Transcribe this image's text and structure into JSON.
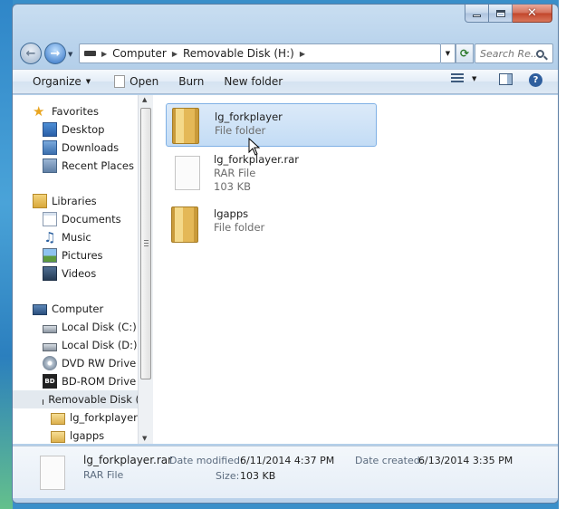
{
  "window": {
    "controls": {
      "minimize": "minimize",
      "maximize": "maximize",
      "close": "close"
    }
  },
  "address": {
    "breadcrumb": [
      "Computer",
      "Removable Disk (H:)"
    ],
    "search_placeholder": "Search Re..."
  },
  "toolbar": {
    "organize": "Organize",
    "open": "Open",
    "burn": "Burn",
    "new_folder": "New folder"
  },
  "nav": {
    "favorites": {
      "header": "Favorites",
      "items": [
        "Desktop",
        "Downloads",
        "Recent Places"
      ]
    },
    "libraries": {
      "header": "Libraries",
      "items": [
        "Documents",
        "Music",
        "Pictures",
        "Videos"
      ]
    },
    "computer": {
      "header": "Computer",
      "items": [
        "Local Disk (C:)",
        "Local Disk (D:)",
        "DVD RW Drive (E:",
        "BD-ROM Drive (G",
        "Removable Disk ("
      ],
      "subitems": [
        "lg_forkplayer",
        "lgapps"
      ]
    }
  },
  "files": [
    {
      "name": "lg_forkplayer",
      "type": "File folder",
      "size": "",
      "icon": "folder-icon",
      "selected": true
    },
    {
      "name": "lg_forkplayer.rar",
      "type": "RAR File",
      "size": "103 KB",
      "icon": "rar-file-icon",
      "selected": false
    },
    {
      "name": "lgapps",
      "type": "File folder",
      "size": "",
      "icon": "folder-icon",
      "selected": false
    }
  ],
  "details": {
    "name": "lg_forkplayer.rar",
    "type": "RAR File",
    "date_modified_label": "Date modified:",
    "date_modified": "6/11/2014 4:37 PM",
    "size_label": "Size:",
    "size": "103 KB",
    "date_created_label": "Date created:",
    "date_created": "6/13/2014 3:35 PM"
  }
}
